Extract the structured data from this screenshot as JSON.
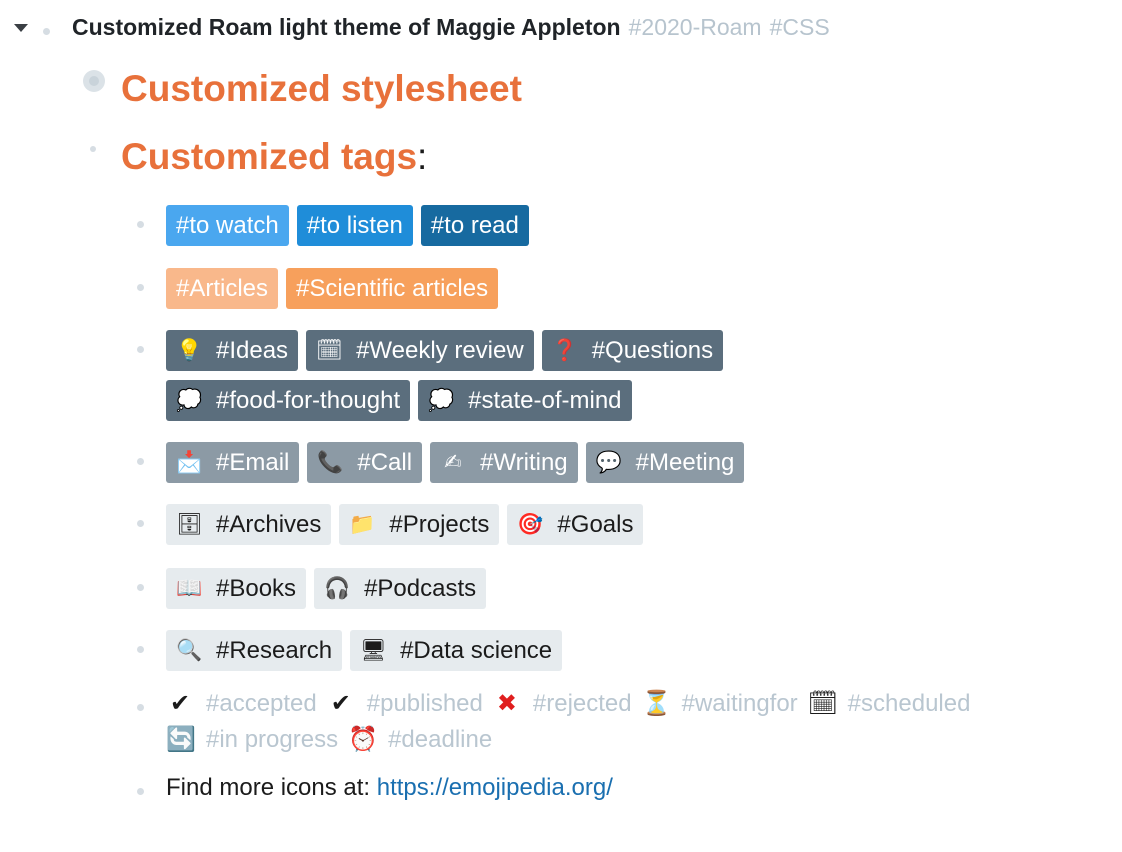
{
  "root": {
    "title": "Customized Roam light theme of Maggie Appleton",
    "tags": [
      "#2020-Roam",
      "#CSS"
    ]
  },
  "headings": {
    "stylesheet": "Customized stylesheet",
    "tags": "Customized tags",
    "tags_suffix": ":"
  },
  "rows": [
    [
      {
        "icon": "",
        "icon_name": "",
        "label": "#to watch",
        "style": "light-blue"
      },
      {
        "icon": "",
        "icon_name": "",
        "label": "#to listen",
        "style": "mid-blue"
      },
      {
        "icon": "",
        "icon_name": "",
        "label": "#to read",
        "style": "dark-blue"
      }
    ],
    [
      {
        "icon": "",
        "icon_name": "",
        "label": "#Articles",
        "style": "peach"
      },
      {
        "icon": "",
        "icon_name": "",
        "label": "#Scientific articles",
        "style": "orange"
      }
    ],
    [
      {
        "icon": "💡",
        "icon_name": "lightbulb-icon",
        "label": "#Ideas",
        "style": "slate"
      },
      {
        "icon": "🗓",
        "icon_name": "calendar-icon",
        "label": "#Weekly review",
        "style": "slate"
      },
      {
        "icon": "❓",
        "icon_name": "question-icon",
        "label": "#Questions",
        "style": "slate"
      }
    ],
    [
      {
        "icon": "💭",
        "icon_name": "thought-bubble-icon",
        "label": "#food-for-thought",
        "style": "slate"
      },
      {
        "icon": "💭",
        "icon_name": "thought-bubble-icon",
        "label": "#state-of-mind",
        "style": "slate"
      }
    ],
    [
      {
        "icon": "📩",
        "icon_name": "envelope-icon",
        "label": "#Email",
        "style": "gray"
      },
      {
        "icon": "📞",
        "icon_name": "phone-icon",
        "label": "#Call",
        "style": "gray"
      },
      {
        "icon": "✍",
        "icon_name": "writing-hand-icon",
        "label": "#Writing",
        "style": "gray"
      },
      {
        "icon": "💬",
        "icon_name": "speech-bubble-icon",
        "label": "#Meeting",
        "style": "gray"
      }
    ],
    [
      {
        "icon": "🗄",
        "icon_name": "file-cabinet-icon",
        "label": "#Archives",
        "style": "pale"
      },
      {
        "icon": "📁",
        "icon_name": "folder-icon",
        "label": "#Projects",
        "style": "pale"
      },
      {
        "icon": "🎯",
        "icon_name": "target-icon",
        "label": "#Goals",
        "style": "pale"
      }
    ],
    [
      {
        "icon": "📖",
        "icon_name": "book-icon",
        "label": "#Books",
        "style": "pale"
      },
      {
        "icon": "🎧",
        "icon_name": "headphones-icon",
        "label": "#Podcasts",
        "style": "pale"
      }
    ],
    [
      {
        "icon": "🔍",
        "icon_name": "magnifier-icon",
        "label": "#Research",
        "style": "pale"
      },
      {
        "icon": "🖥",
        "icon_name": "desktop-computer-icon",
        "label": "#Data science",
        "style": "pale"
      }
    ]
  ],
  "status_lines": [
    [
      {
        "icon": "✔",
        "icon_name": "checkmark-icon",
        "label": "#accepted"
      },
      {
        "icon": "✔",
        "icon_name": "checkmark-icon",
        "label": "#published"
      },
      {
        "icon": "✖",
        "icon_name": "cross-mark-icon",
        "label": "#rejected"
      },
      {
        "icon": "⏳",
        "icon_name": "hourglass-icon",
        "label": "#waitingfor"
      },
      {
        "icon": "🗓",
        "icon_name": "calendar-icon",
        "label": "#scheduled"
      }
    ],
    [
      {
        "icon": "🔄",
        "icon_name": "refresh-icon",
        "label": "#in progress"
      },
      {
        "icon": "⏰",
        "icon_name": "alarm-clock-icon",
        "label": "#deadline"
      }
    ]
  ],
  "footer": {
    "text": "Find more icons at: ",
    "link": "https://emojipedia.org/"
  }
}
